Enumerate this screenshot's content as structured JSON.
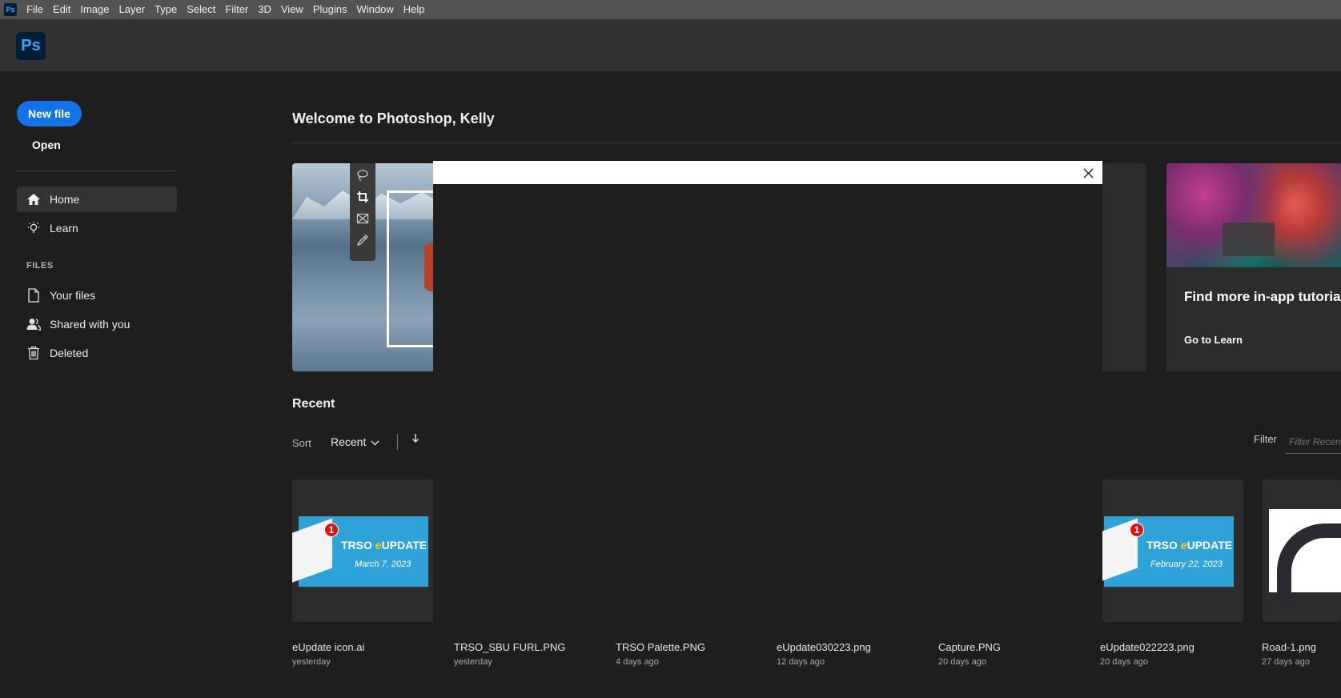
{
  "menubar": {
    "app_icon": "Ps",
    "items": [
      "File",
      "Edit",
      "Image",
      "Layer",
      "Type",
      "Select",
      "Filter",
      "3D",
      "View",
      "Plugins",
      "Window",
      "Help"
    ]
  },
  "appbar": {
    "logo": "Ps"
  },
  "sidebar": {
    "new_file": "New file",
    "open": "Open",
    "nav": [
      {
        "label": "Home",
        "icon": "home-icon",
        "active": true
      },
      {
        "label": "Learn",
        "icon": "lightbulb-icon"
      }
    ],
    "files_heading": "FILES",
    "files_nav": [
      {
        "label": "Your files",
        "icon": "document-icon"
      },
      {
        "label": "Shared with you",
        "icon": "users-icon"
      },
      {
        "label": "Deleted",
        "icon": "trash-icon"
      }
    ]
  },
  "main": {
    "welcome": "Welcome to Photoshop, Kelly",
    "tutorial_card": {
      "title": "Find more in-app tutorials",
      "link": "Go to Learn"
    },
    "recent": {
      "heading": "Recent",
      "sort_label": "Sort",
      "sort_value": "Recent",
      "filter_label": "Filter",
      "filter_placeholder": "Filter Recent files"
    },
    "files": [
      {
        "name": "eUpdate icon.ai",
        "time": "yesterday",
        "thumb_title": "TRSO eUPDATE",
        "thumb_date": "March 7, 2023",
        "badge": "1"
      },
      {
        "name": "TRSO_SBU FURL.PNG",
        "time": "yesterday"
      },
      {
        "name": "TRSO Palette.PNG",
        "time": "4 days ago"
      },
      {
        "name": "eUpdate030223.png",
        "time": "12 days ago"
      },
      {
        "name": "Capture.PNG",
        "time": "20 days ago"
      },
      {
        "name": "eUpdate022223.png",
        "time": "20 days ago",
        "thumb_title": "TRSO eUPDATE",
        "thumb_date": "February 22, 2023",
        "badge": "1"
      },
      {
        "name": "Road-1.png",
        "time": "27 days ago"
      }
    ]
  },
  "colors": {
    "accent": "#1473e6",
    "ps_blue": "#31a8ff",
    "ps_navy": "#001e36",
    "background": "#1e1e1e"
  }
}
